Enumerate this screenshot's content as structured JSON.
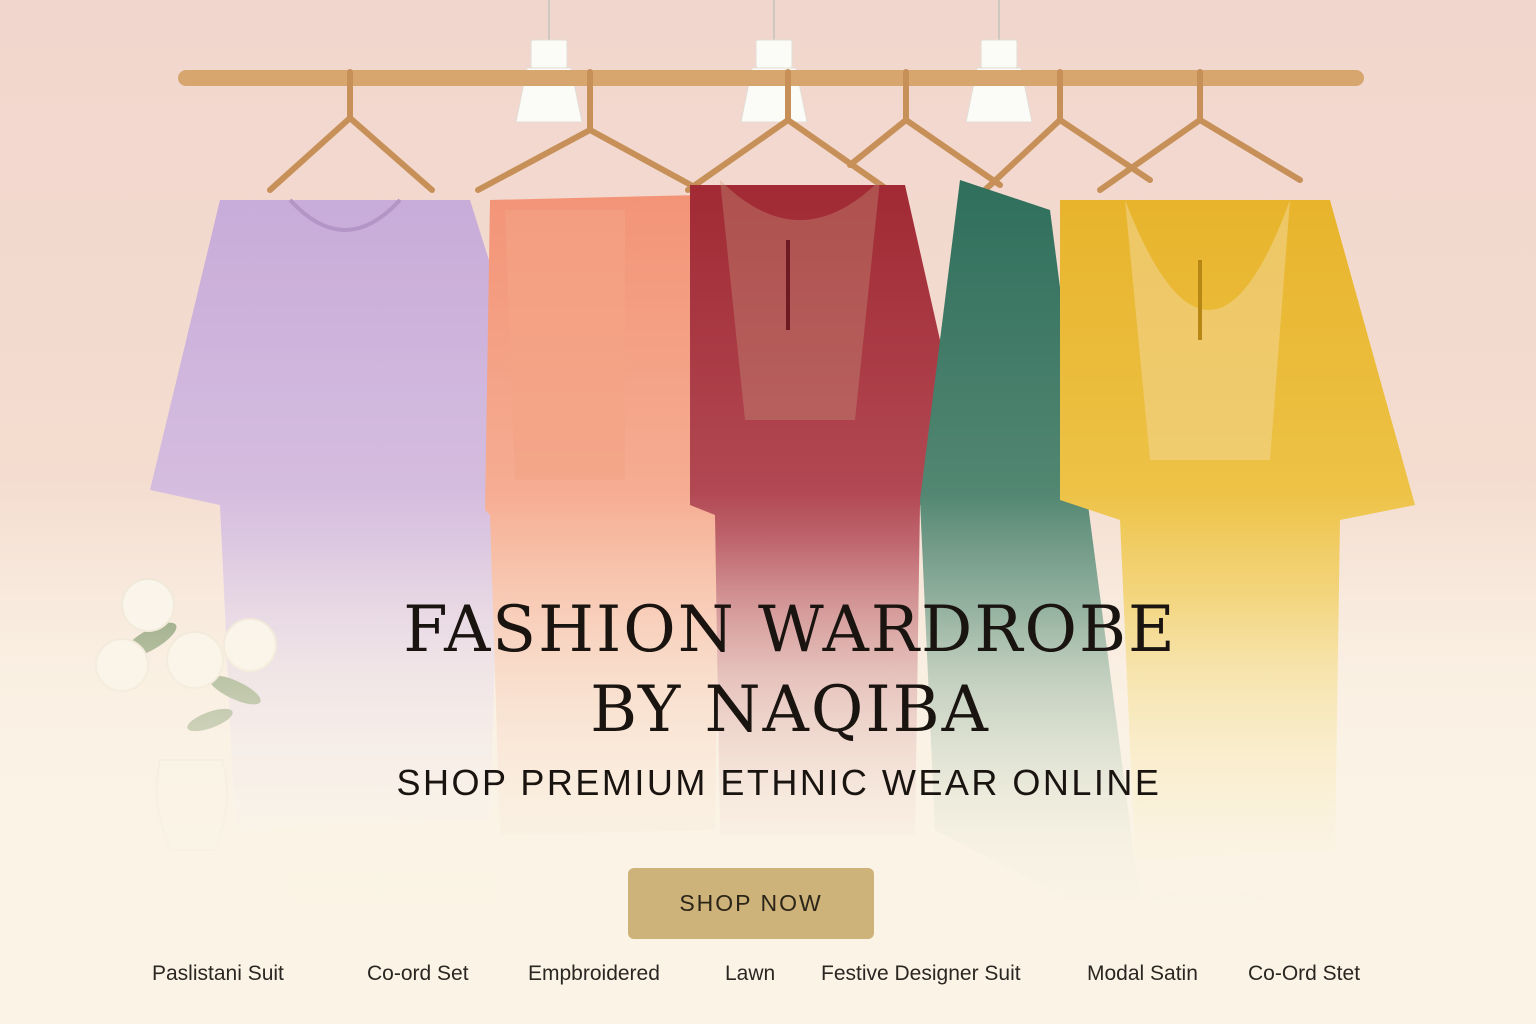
{
  "hero": {
    "title_line1": "FASHION WARDROBE",
    "title_line2": "BY NAQIBA",
    "subtitle": "SHOP PREMIUM ETHNIC WEAR ONLINE",
    "cta_label": "SHOP NOW"
  },
  "categories": [
    {
      "label": "Paslistani Suit"
    },
    {
      "label": "Co-ord Set"
    },
    {
      "label": "Empbroidered"
    },
    {
      "label": "Lawn"
    },
    {
      "label": "Festive Designer Suit"
    },
    {
      "label": "Modal Satin"
    },
    {
      "label": "Co-Ord Stet"
    }
  ],
  "colors": {
    "background": "#f4dccf",
    "cta": "#cdb27a",
    "kurta_lavender": "#c2a6d6",
    "kurta_peach": "#f29a7c",
    "kurta_maroon": "#9c2b33",
    "kurta_green": "#3f7a66",
    "kurta_yellow": "#e7b52f",
    "rail_wood": "#d2a06a"
  }
}
